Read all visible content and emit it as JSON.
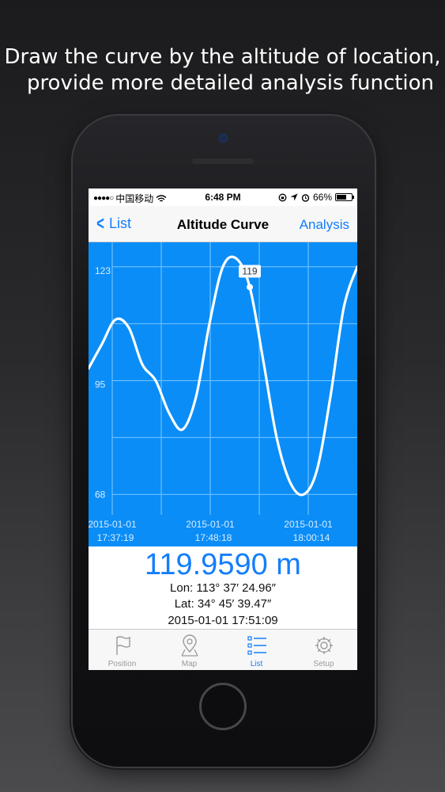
{
  "promo": {
    "line1": "Draw the curve by the altitude of location,",
    "line2": "provide more detailed analysis function"
  },
  "status_bar": {
    "signal": "●●●●○",
    "carrier": "中国移动",
    "time": "6:48 PM",
    "battery": "66%",
    "battery_level": 0.66
  },
  "nav": {
    "back_label": "List",
    "title": "Altitude Curve",
    "analysis_label": "Analysis"
  },
  "chart_data": {
    "type": "line",
    "y_ticks": [
      "123",
      "95",
      "68"
    ],
    "y_tick_values": [
      123,
      95,
      68
    ],
    "x_ticks": [
      {
        "date": "2015-01-01",
        "time": "17:37:19"
      },
      {
        "date": "2015-01-01",
        "time": "17:48:18"
      },
      {
        "date": "2015-01-01",
        "time": "18:00:14"
      }
    ],
    "ylim": [
      63,
      130
    ],
    "grid": true,
    "marker": {
      "label": "119",
      "value": 119
    },
    "series": [
      {
        "values": [
          99,
          105,
          111,
          109,
          100,
          96,
          88,
          84,
          92,
          110,
          124,
          126,
          119,
          101,
          82,
          71,
          68,
          74,
          92,
          114,
          124
        ]
      }
    ],
    "marker_index": 12,
    "colors": {
      "background": "#0a8df7",
      "grid": "#6fc1ff",
      "line": "#ffffff",
      "label": "#d8ecff"
    }
  },
  "readout": {
    "altitude": "119.9590 m",
    "lon": "Lon: 113° 37′ 24.96″",
    "lat": "Lat: 34° 45′ 39.47″",
    "datetime": "2015-01-01 17:51:09"
  },
  "tabs": [
    {
      "label": "Position",
      "icon": "flag-icon",
      "active": false
    },
    {
      "label": "Map",
      "icon": "map-pin-icon",
      "active": false
    },
    {
      "label": "List",
      "icon": "list-icon",
      "active": true
    },
    {
      "label": "Setup",
      "icon": "gear-icon",
      "active": false
    }
  ]
}
